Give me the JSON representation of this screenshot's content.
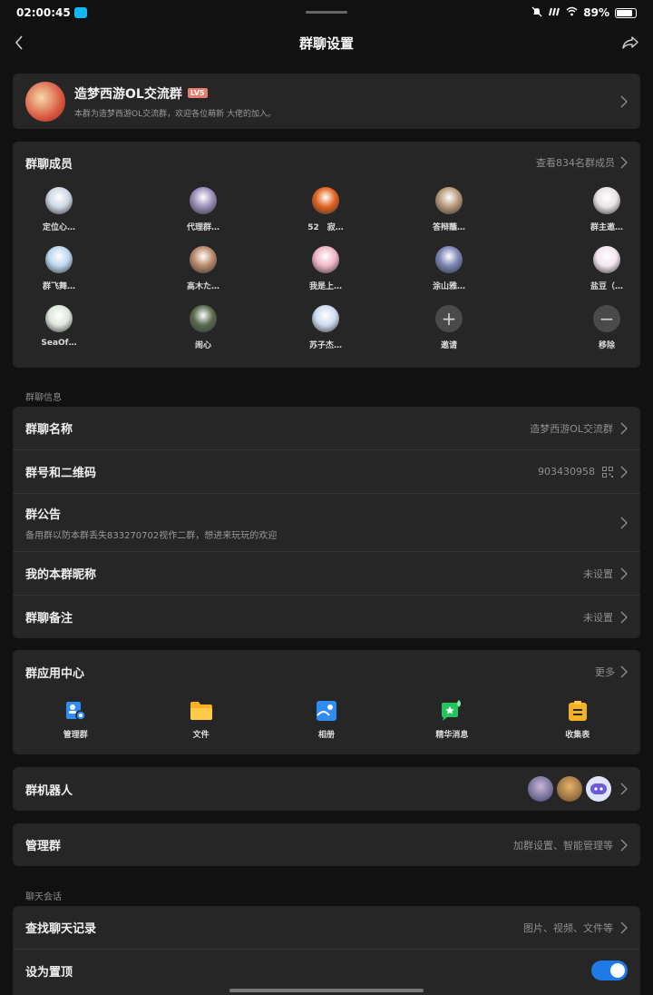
{
  "status": {
    "time": "02:00:45",
    "battery": "89%"
  },
  "nav": {
    "title": "群聊设置"
  },
  "group": {
    "name": "造梦西游OL交流群",
    "level": "LV5",
    "desc": "本群为造梦西游OL交流群，欢迎各位萌新 大佬的加入。"
  },
  "members": {
    "title": "群聊成员",
    "view_all": "查看834名群成员",
    "list": [
      {
        "name": "定位心…",
        "color": "#cfd8e6"
      },
      {
        "name": "代理群…",
        "color": "#9b8fb8"
      },
      {
        "name": "52　寂…",
        "color": "#e2631f"
      },
      {
        "name": "答辩蘸…",
        "color": "#b79a7a"
      },
      {
        "name": "群主邀…",
        "color": "#e9e4e6"
      },
      {
        "name": "群飞舞…",
        "color": "#bcd8ef"
      },
      {
        "name": "高木た…",
        "color": "#b88a6a"
      },
      {
        "name": "我是上…",
        "color": "#f0b6c6"
      },
      {
        "name": "涂山雅…",
        "color": "#7c84b4"
      },
      {
        "name": "盐豆（…",
        "color": "#f2e6ee"
      },
      {
        "name": "SeaOf…",
        "color": "#dfe8dd"
      },
      {
        "name": "闹心",
        "color": "#5a6b4f"
      },
      {
        "name": "苏子杰…",
        "color": "#cfdcf0"
      }
    ],
    "invite": "邀请",
    "remove": "移除"
  },
  "info_section": "群聊信息",
  "info": {
    "name_label": "群聊名称",
    "name_value": "造梦西游OL交流群",
    "id_label": "群号和二维码",
    "id_value": "903430958",
    "notice_label": "群公告",
    "notice_text": "备用群以防本群丢失833270702视作二群，想进来玩玩的欢迎",
    "nick_label": "我的本群昵称",
    "nick_value": "未设置",
    "remark_label": "群聊备注",
    "remark_value": "未设置"
  },
  "apps": {
    "title": "群应用中心",
    "more": "更多",
    "items": [
      {
        "label": "管理群",
        "icon": "manage-group-icon",
        "color": "#2f8cf2"
      },
      {
        "label": "文件",
        "icon": "folder-icon",
        "color": "#f4b223"
      },
      {
        "label": "相册",
        "icon": "album-icon",
        "color": "#2f8cf2"
      },
      {
        "label": "精华消息",
        "icon": "essence-message-icon",
        "color": "#22c55e"
      },
      {
        "label": "收集表",
        "icon": "clipboard-icon",
        "color": "#f4b223"
      }
    ]
  },
  "robot": {
    "label": "群机器人"
  },
  "manage": {
    "label": "管理群",
    "value": "加群设置、智能管理等"
  },
  "chat_section": "聊天会话",
  "chat": {
    "search_label": "查找聊天记录",
    "search_value": "图片、视频、文件等",
    "pin_label": "设为置顶",
    "pin_on": true
  }
}
